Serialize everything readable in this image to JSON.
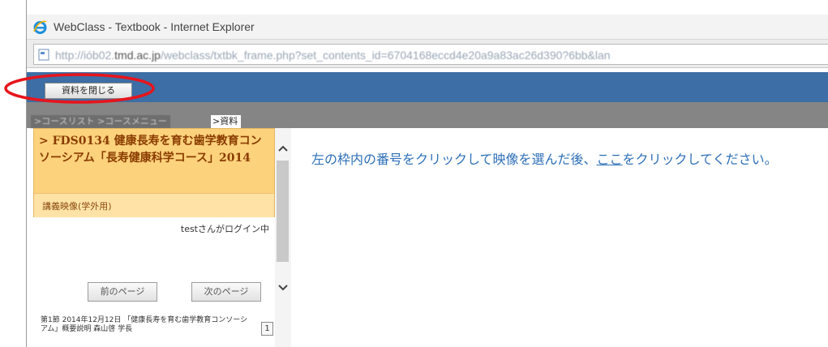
{
  "window": {
    "title": "WebClass - Textbook - Internet Explorer",
    "url_prefix": "http://iób02.",
    "url_host": "tmd.ac.jp",
    "url_rest": "/webclass/txtbk_frame.php?set_contents_id=6704168eccd4e20a9a83ac26d390?6bb&lan"
  },
  "toolbar": {
    "close_label": "資料を閉じる"
  },
  "breadcrumb": {
    "links": ">コースリスト >コースメニュー",
    "current": ">資料"
  },
  "sidebar": {
    "course_title": "> FDS0134 健康長寿を育む歯学教育コンソーシアム「長寿健康科学コース」2014",
    "lecture_label": "講義映像(学外用)",
    "login_status": "testさんがログイン中",
    "prev_page_label": "前のページ",
    "next_page_label": "次のページ",
    "lecture_item": "第1節 2014年12月12日 「健康長寿を育む歯学教育コンソーシアム」概要説明 森山啓 学長",
    "item_number": "1"
  },
  "main": {
    "instruction_before": "左の枠内の番号をクリックして映像を選んだ後、",
    "instruction_link": "ここ",
    "instruction_after": "をクリックしてください。"
  },
  "colors": {
    "header_blue": "#3d6ea5",
    "breadcrumb_gray": "#858585",
    "course_box": "#fdd27c",
    "instruction_text": "#2e6fb8",
    "highlight_ellipse": "#e8141b"
  },
  "icons": [
    "ie-logo-icon",
    "page-icon",
    "chevron-up-icon",
    "chevron-down-icon"
  ]
}
